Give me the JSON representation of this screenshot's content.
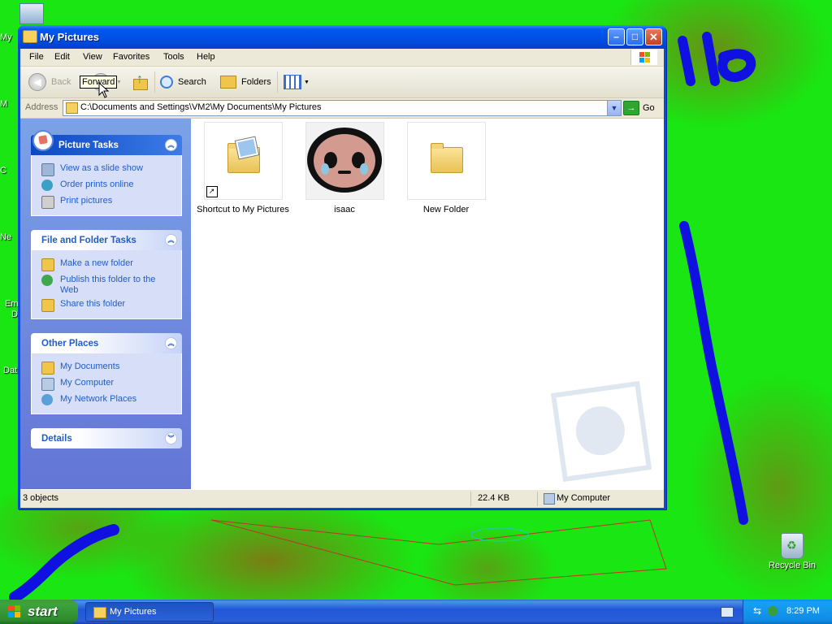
{
  "desktop": {
    "edge_labels": [
      "My",
      "M",
      "C",
      "Ne",
      "Em",
      "D",
      "Dat"
    ],
    "recycle_bin_label": "Recycle Bin"
  },
  "window": {
    "title": "My Pictures",
    "buttons": {
      "minimize": "–",
      "maximize": "□",
      "close": "✕"
    }
  },
  "menu": [
    "File",
    "Edit",
    "View",
    "Favorites",
    "Tools",
    "Help"
  ],
  "toolbar": {
    "back_label": "Back",
    "search_label": "Search",
    "folders_label": "Folders",
    "tooltip": "Forward"
  },
  "address": {
    "label": "Address",
    "value": "C:\\Documents and Settings\\VM2\\My Documents\\My Pictures",
    "go_label": "Go"
  },
  "panels": {
    "picture_tasks": {
      "title": "Picture Tasks",
      "items": [
        "View as a slide show",
        "Order prints online",
        "Print pictures"
      ]
    },
    "file_folder_tasks": {
      "title": "File and Folder Tasks",
      "items": [
        "Make a new folder",
        "Publish this folder to the Web",
        "Share this folder"
      ]
    },
    "other_places": {
      "title": "Other Places",
      "items": [
        "My Documents",
        "My Computer",
        "My Network Places"
      ]
    },
    "details": {
      "title": "Details"
    }
  },
  "files": [
    {
      "name": "Shortcut to My Pictures",
      "type": "shortcut"
    },
    {
      "name": "isaac",
      "type": "image"
    },
    {
      "name": "New Folder",
      "type": "folder"
    }
  ],
  "status": {
    "objects": "3 objects",
    "size": "22.4 KB",
    "location": "My Computer"
  },
  "taskbar": {
    "start_label": "start",
    "task_button_label": "My Pictures",
    "clock": "8:29 PM"
  },
  "colors": {
    "desktop_bg": "#19e612",
    "link": "#215dc6",
    "titlebar": "#0058ee",
    "start_green": "#3ca43c"
  }
}
